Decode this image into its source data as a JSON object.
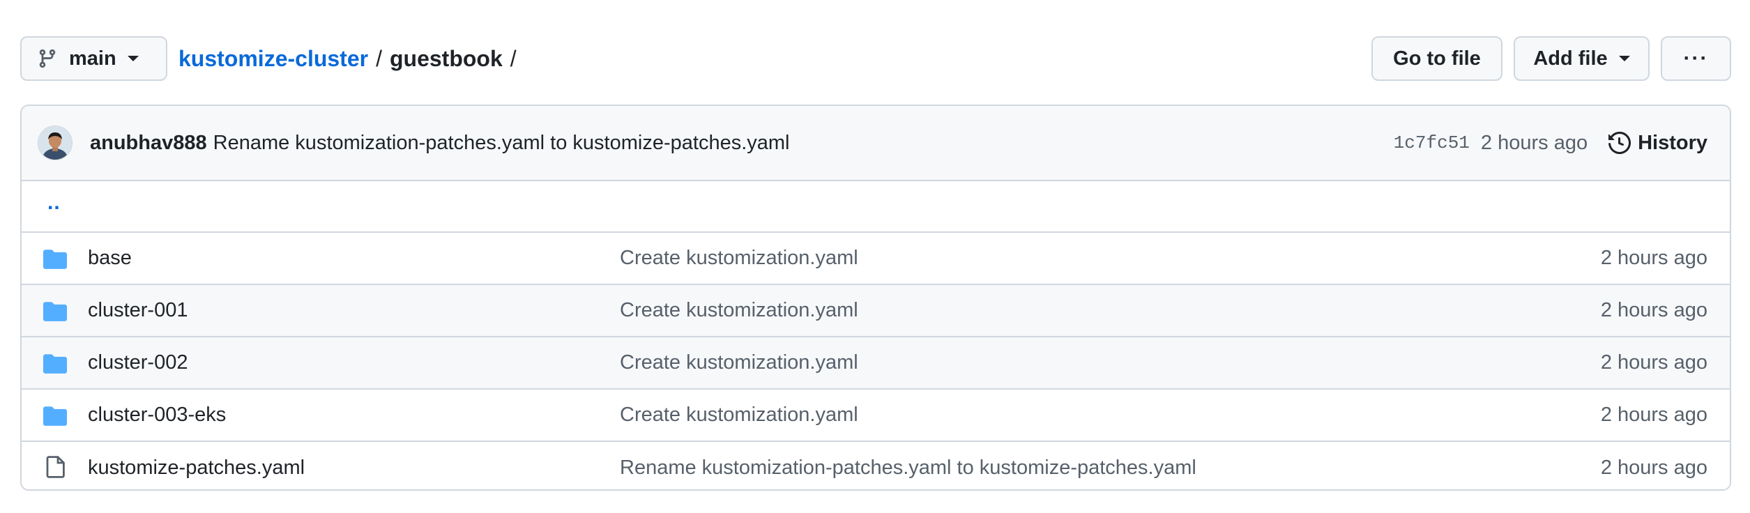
{
  "top": {
    "branch": "main",
    "breadcrumb": {
      "repo": "kustomize-cluster",
      "sep1": "/",
      "dir": "guestbook",
      "sep2": "/"
    },
    "go_to_file": "Go to file",
    "add_file": "Add file",
    "more": "···"
  },
  "commit": {
    "author": "anubhav888",
    "message": "Rename kustomization-patches.yaml to kustomize-patches.yaml",
    "sha": "1c7fc51",
    "time": "2 hours ago",
    "history": "History"
  },
  "up_link": "..",
  "files": [
    {
      "name": "base",
      "type": "folder-icon",
      "commit": "Create kustomization.yaml",
      "time": "2 hours ago"
    },
    {
      "name": "cluster-001",
      "type": "folder-icon",
      "commit": "Create kustomization.yaml",
      "time": "2 hours ago"
    },
    {
      "name": "cluster-002",
      "type": "folder-icon",
      "commit": "Create kustomization.yaml",
      "time": "2 hours ago"
    },
    {
      "name": "cluster-003-eks",
      "type": "folder-icon",
      "commit": "Create kustomization.yaml",
      "time": "2 hours ago"
    },
    {
      "name": "kustomize-patches.yaml",
      "type": "file-icon",
      "commit": "Rename kustomization-patches.yaml to kustomize-patches.yaml",
      "time": "2 hours ago"
    }
  ],
  "colors": {
    "link": "#0969da",
    "folder": "#54aeff",
    "border": "#d0d7de",
    "muted": "#57606a"
  }
}
